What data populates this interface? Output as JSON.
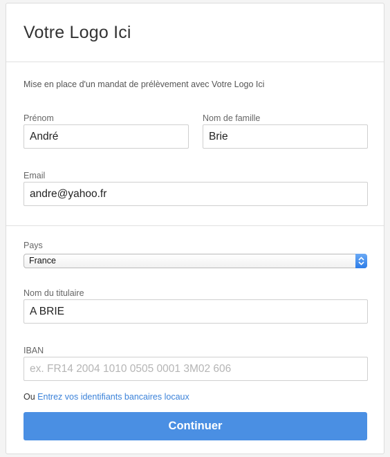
{
  "header": {
    "title": "Votre Logo Ici"
  },
  "intro_text": "Mise en place d'un mandat de prélèvement avec Votre Logo Ici",
  "form": {
    "first_name": {
      "label": "Prénom",
      "value": "André"
    },
    "last_name": {
      "label": "Nom de famille",
      "value": "Brie"
    },
    "email": {
      "label": "Email",
      "value": "andre@yahoo.fr"
    },
    "country": {
      "label": "Pays",
      "selected": "France"
    },
    "account_holder": {
      "label": "Nom du titulaire",
      "value": "A BRIE"
    },
    "iban": {
      "label": "IBAN",
      "value": "",
      "placeholder": "ex. FR14 2004 1010 0505 0001 3M02 606"
    },
    "alt_prefix": "Ou",
    "alt_link": "Entrez vos identifiants bancaires locaux",
    "submit_label": "Continuer"
  },
  "colors": {
    "accent": "#4a8fe3",
    "link": "#3b82d9"
  }
}
